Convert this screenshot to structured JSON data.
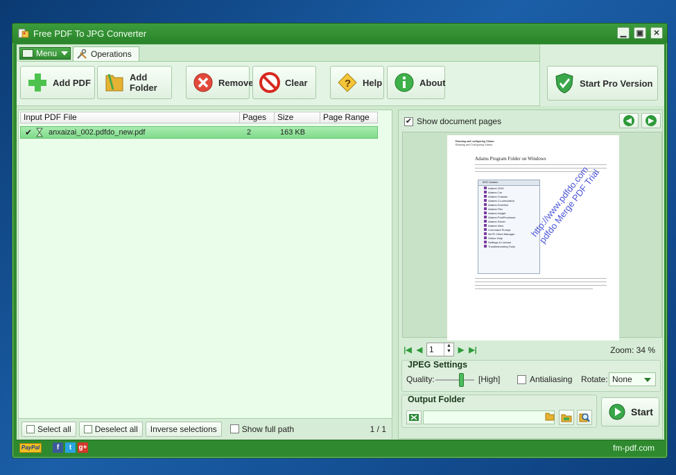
{
  "window": {
    "title": "Free PDF To JPG Converter"
  },
  "tabs": {
    "menu_label": "Menu",
    "operations_label": "Operations"
  },
  "toolbar": {
    "add_pdf": "Add PDF",
    "add_folder": "Add Folder",
    "remove": "Remove",
    "clear": "Clear",
    "help": "Help",
    "about": "About",
    "start_pro": "Start Pro Version"
  },
  "file_list": {
    "columns": [
      "Input PDF File",
      "Pages",
      "Size",
      "Page Range"
    ],
    "rows": [
      {
        "checked": true,
        "file": "anxaizai_002.pdfdo_new.pdf",
        "pages": "2",
        "size": "163 KB",
        "range": ""
      }
    ]
  },
  "list_footer": {
    "select_all": "Select all",
    "deselect_all": "Deselect all",
    "inverse": "Inverse selections",
    "show_full_path": "Show full path",
    "page_indicator": "1 / 1"
  },
  "preview": {
    "show_pages_label": "Show document pages",
    "page_header": "Running and configuring Adams",
    "page_subheader": "Running and Configuring Adams",
    "page_title": "Adams Program Folder on Windows",
    "screen_title": "MSC Adams",
    "screen_items": [
      "Adams 2019",
      "Adams Car",
      "Adams Chassis",
      "Adams Co-simulation",
      "Adams Driveline",
      "Adams Flex",
      "Adams Insight",
      "Adams PostProcessor",
      "Adams Solver",
      "Adams View",
      "Command Prompt",
      "NLFE Client Manager",
      "Online Help",
      "Settings & License",
      "Troubleshooting Tools"
    ],
    "watermark_line1": "http://www.pdfdo.com",
    "watermark_line2": "pdfdo Merge PDF Trial",
    "page_number": "1",
    "zoom_label": "Zoom: 34 %"
  },
  "jpeg_settings": {
    "title": "JPEG Settings",
    "quality_label": "Quality:",
    "quality_value": "[High]",
    "quality_level": 0.6,
    "antialiasing_label": "Antialiasing",
    "rotate_label": "Rotate:",
    "rotate_value": "None"
  },
  "output": {
    "title": "Output Folder",
    "path": "",
    "start_label": "Start"
  },
  "status": {
    "paypal": "PayPal",
    "site": "fm-pdf.com"
  },
  "colors": {
    "frame": "#2f8a2f",
    "panel": "#cfe9cf",
    "selection": "#8fe09a"
  }
}
